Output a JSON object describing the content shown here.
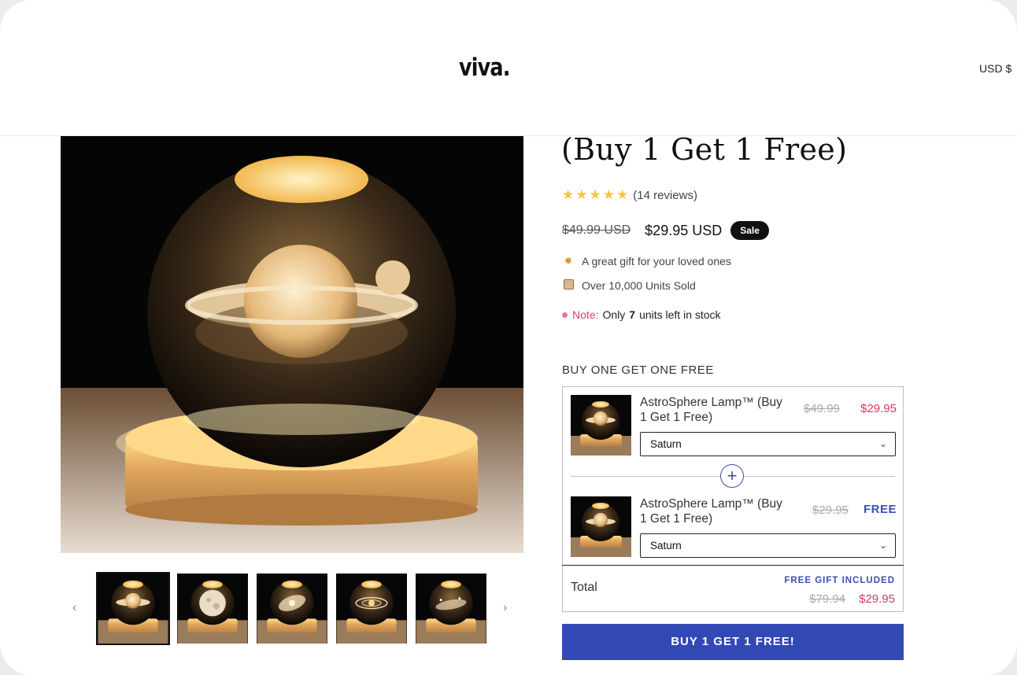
{
  "header": {
    "logo": "viva.",
    "currency": "USD $"
  },
  "product": {
    "title_visible": "(Buy 1 Get 1 Free)",
    "rating": {
      "stars": 5,
      "reviews_text": "(14 reviews)"
    },
    "price": {
      "old": "$49.99 USD",
      "new": "$29.95 USD",
      "badge": "Sale"
    },
    "features": [
      {
        "icon": "sparkle-icon",
        "text": "A great gift for your loved ones"
      },
      {
        "icon": "box-icon",
        "text": "Over 10,000 Units Sold"
      }
    ],
    "stock": {
      "note_label": "Note:",
      "prefix": "Only",
      "count": "7",
      "suffix": "units left in stock"
    }
  },
  "gallery": {
    "thumbnails": [
      "saturn",
      "moon",
      "galaxy",
      "solar-system",
      "milky-way"
    ],
    "active_index": 0
  },
  "bundle": {
    "label": "BUY ONE GET ONE FREE",
    "items": [
      {
        "name": "AstroSphere Lamp™ (Buy 1 Get 1 Free)",
        "old_price": "$49.99",
        "new_price": "$29.95",
        "variant": "Saturn"
      },
      {
        "name": "AstroSphere Lamp™ (Buy 1 Get 1 Free)",
        "old_price": "$29.95",
        "new_price": "FREE",
        "variant": "Saturn"
      }
    ],
    "total": {
      "label": "Total",
      "gift_text": "FREE GIFT INCLUDED",
      "old": "$79.94",
      "new": "$29.95"
    }
  },
  "cta": {
    "label": "BUY 1 GET 1 FREE!"
  },
  "colors": {
    "accent": "#3249b5",
    "sale_red": "#d43a5b",
    "star": "#f5c542"
  }
}
